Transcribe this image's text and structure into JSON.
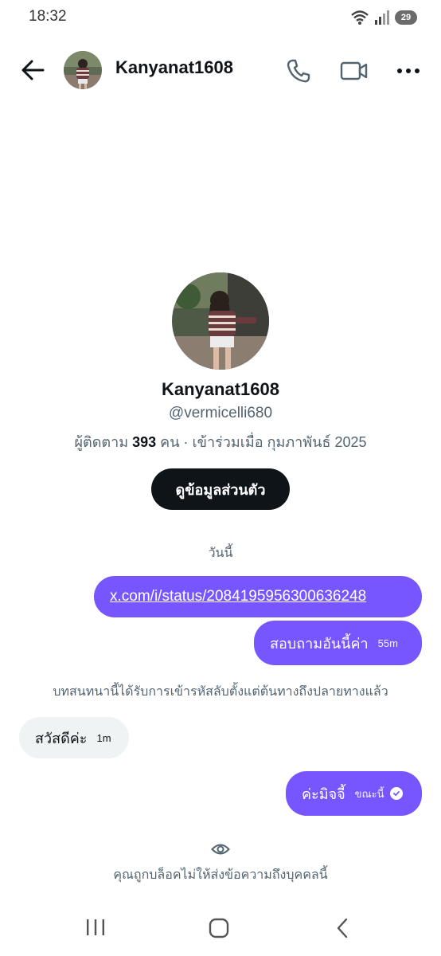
{
  "status_bar": {
    "time": "18:32",
    "battery": "29"
  },
  "header": {
    "username": "Kanyanat1608"
  },
  "profile": {
    "name": "Kanyanat1608",
    "handle": "@vermicelli680",
    "followers_label": "ผู้ติดตาม",
    "followers_count": "393",
    "followers_unit": "คน · เข้าร่วมเมื่อ กุมภาพันธ์ 2025",
    "view_profile_button": "ดูข้อมูลส่วนตัว"
  },
  "conversation": {
    "date_separator": "วันนี้",
    "encryption_note": "บทสนทนานี้ได้รับการเข้ารหัสลับตั้งแต่ต้นทางถึงปลายทางแล้ว",
    "messages": [
      {
        "direction": "outgoing",
        "text": "x.com/i/status/2084195956300636248",
        "time": ""
      },
      {
        "direction": "outgoing",
        "text": "สอบถามอันนี้ค่า",
        "time": "55m"
      },
      {
        "direction": "incoming",
        "text": "สวัสดีค่ะ",
        "time": "1m"
      },
      {
        "direction": "outgoing",
        "text": "ค่ะมิจจี้",
        "time": "ขณะนี้"
      }
    ],
    "blocked_note": "คุณถูกบล็อคไม่ให้ส่งข้อความถึงบุคคลนี้"
  },
  "colors": {
    "accent": "#7856ff",
    "incoming_bubble": "#eff3f4",
    "button_bg": "#0f1419"
  }
}
